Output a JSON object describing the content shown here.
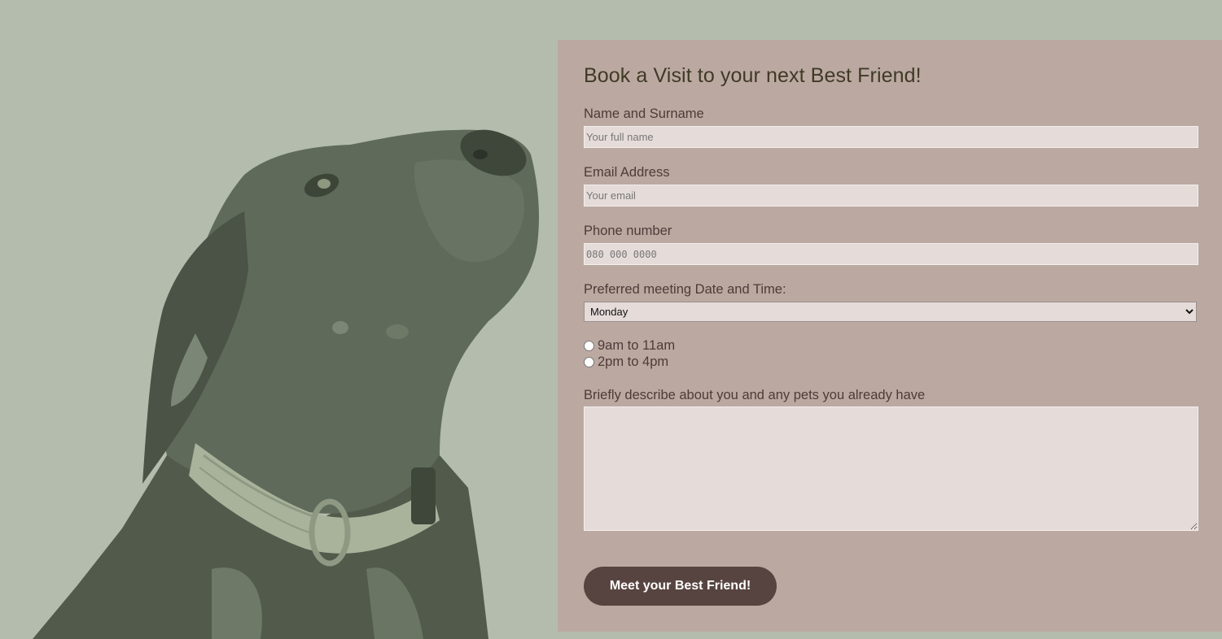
{
  "colors": {
    "page_background": "#b4bdad",
    "form_background": "#bba9a1",
    "input_background": "#e5dcd9",
    "title_color": "#3f3a25",
    "label_color": "#4e3a38",
    "button_background": "#574440",
    "button_text": "#ffffff",
    "dog_tint": "#5f6a5a"
  },
  "hero": {
    "image": "dog-with-collar-image"
  },
  "form": {
    "title": "Book a Visit to your next Best Friend!",
    "name": {
      "label": "Name and Surname",
      "placeholder": "Your full name",
      "value": ""
    },
    "email": {
      "label": "Email Address",
      "placeholder": "Your email",
      "value": ""
    },
    "phone": {
      "label": "Phone number",
      "placeholder": "080 000 0000",
      "value": ""
    },
    "meeting": {
      "label": "Preferred meeting Date and Time:",
      "selected_day": "Monday",
      "time_slots": [
        "9am to 11am",
        "2pm to 4pm"
      ]
    },
    "description": {
      "label": "Briefly describe about you and any pets you already have",
      "value": ""
    },
    "submit_label": "Meet your Best Friend!"
  }
}
